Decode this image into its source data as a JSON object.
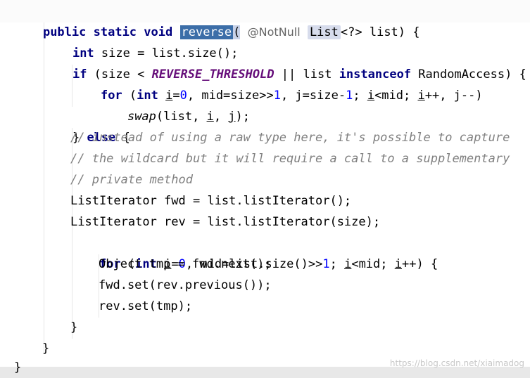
{
  "editor": {
    "method_name": "reverse",
    "lines": {
      "l1": {
        "public": "public",
        "static": "static",
        "void": "void",
        "paren": "(",
        "annotation": "@NotNull",
        "list_type": "List",
        "generic": "<?>",
        "param": " list) {"
      },
      "l2": {
        "int": "int",
        "rest": " size = list.size();"
      },
      "l3": {
        "if": "if",
        "open": " (size < ",
        "const": "REVERSE_THRESHOLD",
        "mid": " || list ",
        "instanceof": "instanceof",
        "rest": " RandomAccess) {"
      },
      "l4": {
        "for": "for",
        "open": " (",
        "int": "int",
        "sp": " ",
        "i1": "i",
        "eq0": "=",
        "zero": "0",
        "mid1": ", mid=size>>",
        "one": "1",
        "j_part": ", j=size-",
        "one2": "1",
        "semi": "; ",
        "i2": "i",
        "lt": "<mid; ",
        "i3": "i",
        "inc": "++, j--)"
      },
      "l5": {
        "swap": "swap",
        "open": "(list, ",
        "i": "i",
        "comma": ", ",
        "j": "j",
        "close": ");"
      },
      "l6": {
        "brace": "} ",
        "else": "else",
        "rest": " {"
      },
      "l7": "// instead of using a raw type here, it's possible to capture",
      "l8": "// the wildcard but it will require a call to a supplementary",
      "l9": "// private method",
      "l10": "ListIterator fwd = list.listIterator();",
      "l11": "ListIterator rev = list.listIterator(size);",
      "l12": {
        "for": "for",
        "open": " (",
        "int": "int",
        "sp": " ",
        "i1": "i",
        "eq": "=",
        "zero": "0",
        "mid": ", mid=list.size()>>",
        "one": "1",
        "semi": "; ",
        "i2": "i",
        "lt": "<mid; ",
        "i3": "i",
        "rest": "++) {"
      },
      "l13": "Object tmp = fwd.next();",
      "l14": "fwd.set(rev.previous());",
      "l15": "rev.set(tmp);",
      "l16": "}",
      "l17": "}",
      "l18": "}"
    },
    "watermark": "https://blog.csdn.net/xiaimadog",
    "colors": {
      "keyword": "#000080",
      "comment": "#808080",
      "number": "#0000ff",
      "constant": "#660e7a",
      "selection": "#3c6ea8"
    }
  }
}
